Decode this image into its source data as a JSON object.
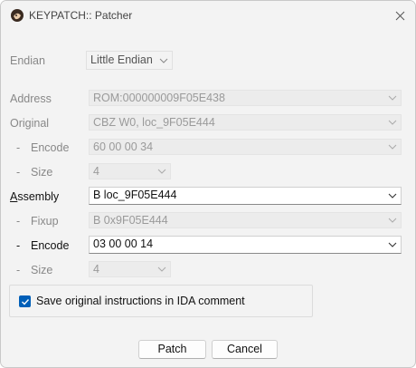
{
  "window": {
    "title": "KEYPATCH:: Patcher"
  },
  "form": {
    "endian": {
      "label": "Endian",
      "value": "Little Endian"
    },
    "address": {
      "label": "Address",
      "value": "ROM:000000009F05E438"
    },
    "original": {
      "label": "Original",
      "value": "CBZ W0, loc_9F05E444"
    },
    "original_encode": {
      "dash": "-",
      "label": "Encode",
      "value": "60 00 00 34"
    },
    "original_size": {
      "dash": "-",
      "label": "Size",
      "value": "4"
    },
    "assembly": {
      "label": "Assembly",
      "value": "B loc_9F05E444"
    },
    "fixup": {
      "dash": "-",
      "label": "Fixup",
      "value": "B 0x9F05E444"
    },
    "assembly_encode": {
      "dash": "-",
      "label": "Encode",
      "value": "03 00 00 14"
    },
    "assembly_size": {
      "dash": "-",
      "label": "Size",
      "value": "4"
    }
  },
  "options": {
    "save_comment": {
      "label": "Save original instructions in IDA comment",
      "checked": true
    }
  },
  "buttons": {
    "patch": "Patch",
    "cancel": "Cancel"
  },
  "colors": {
    "accent": "#005fb8",
    "window_bg": "#f3f3f3",
    "disabled_text": "#9a9a9a"
  }
}
